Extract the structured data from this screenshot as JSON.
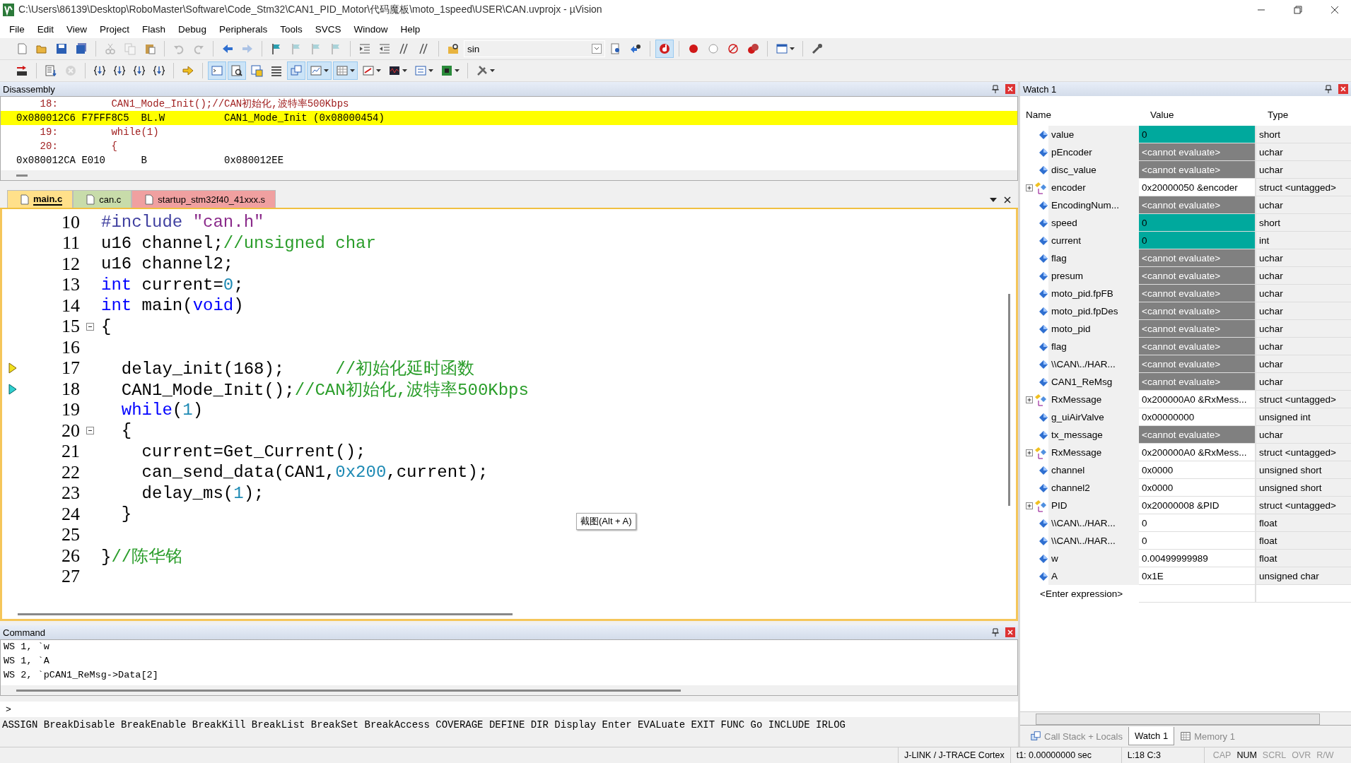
{
  "window": {
    "title": "C:\\Users\\86139\\Desktop\\RoboMaster\\Software\\Code_Stm32\\CAN1_PID_Motor\\代码魔板\\moto_1speed\\USER\\CAN.uvprojx - µVision"
  },
  "menu": [
    "File",
    "Edit",
    "View",
    "Project",
    "Flash",
    "Debug",
    "Peripherals",
    "Tools",
    "SVCS",
    "Window",
    "Help"
  ],
  "toolbars": [
    {
      "items": [
        {
          "kind": "new",
          "pressed": false,
          "disabled": false,
          "dropdown": false
        },
        {
          "kind": "open",
          "pressed": false,
          "disabled": false,
          "dropdown": false
        },
        {
          "kind": "save",
          "pressed": false,
          "disabled": false,
          "dropdown": false
        },
        {
          "kind": "saveall",
          "pressed": false,
          "disabled": false,
          "dropdown": false
        },
        {
          "kind": "separator"
        },
        {
          "kind": "cut",
          "pressed": false,
          "disabled": true,
          "dropdown": false
        },
        {
          "kind": "copy",
          "pressed": false,
          "disabled": true,
          "dropdown": false
        },
        {
          "kind": "paste",
          "pressed": false,
          "disabled": false,
          "dropdown": false
        },
        {
          "kind": "separator"
        },
        {
          "kind": "undo",
          "pressed": false,
          "disabled": true,
          "dropdown": false
        },
        {
          "kind": "redo",
          "pressed": false,
          "disabled": true,
          "dropdown": false
        },
        {
          "kind": "separator"
        },
        {
          "kind": "back",
          "pressed": false,
          "disabled": false,
          "dropdown": false
        },
        {
          "kind": "forward",
          "pressed": false,
          "disabled": true,
          "dropdown": false
        },
        {
          "kind": "separator"
        },
        {
          "kind": "bookmark",
          "pressed": false,
          "disabled": false,
          "dropdown": false
        },
        {
          "kind": "bookmark",
          "pressed": false,
          "disabled": true,
          "dropdown": false
        },
        {
          "kind": "bookmark",
          "pressed": false,
          "disabled": true,
          "dropdown": false
        },
        {
          "kind": "bookmark",
          "pressed": false,
          "disabled": true,
          "dropdown": false
        },
        {
          "kind": "separator"
        },
        {
          "kind": "indent",
          "pressed": false,
          "disabled": false,
          "dropdown": false
        },
        {
          "kind": "outdent",
          "pressed": false,
          "disabled": false,
          "dropdown": false
        },
        {
          "kind": "comment",
          "pressed": false,
          "disabled": false,
          "dropdown": false
        },
        {
          "kind": "comment",
          "pressed": false,
          "disabled": false,
          "dropdown": false
        },
        {
          "kind": "separator"
        },
        {
          "kind": "findfiles",
          "pressed": false,
          "disabled": false,
          "dropdown": false
        },
        {
          "kind": "combo",
          "value": "sin"
        },
        {
          "kind": "find",
          "pressed": false,
          "disabled": false,
          "dropdown": false
        },
        {
          "kind": "findnext",
          "pressed": false,
          "disabled": false,
          "dropdown": false
        },
        {
          "kind": "separator"
        },
        {
          "kind": "debug",
          "pressed": true,
          "disabled": false,
          "dropdown": false
        },
        {
          "kind": "separator"
        },
        {
          "kind": "breakpoint",
          "pressed": false,
          "disabled": false,
          "dropdown": false
        },
        {
          "kind": "bpempty",
          "pressed": false,
          "disabled": false,
          "dropdown": false
        },
        {
          "kind": "bpdisable",
          "pressed": false,
          "disabled": false,
          "dropdown": false
        },
        {
          "kind": "bpkill",
          "pressed": false,
          "disabled": false,
          "dropdown": false
        },
        {
          "kind": "separator"
        },
        {
          "kind": "windows",
          "pressed": false,
          "disabled": false,
          "dropdown": true
        },
        {
          "kind": "separator"
        },
        {
          "kind": "wrench",
          "pressed": false,
          "disabled": false,
          "dropdown": false
        }
      ]
    },
    {
      "items": [
        {
          "kind": "reset",
          "pressed": false,
          "disabled": false,
          "dropdown": false
        },
        {
          "kind": "separator"
        },
        {
          "kind": "run",
          "pressed": false,
          "disabled": false,
          "dropdown": false
        },
        {
          "kind": "stop",
          "pressed": false,
          "disabled": true,
          "dropdown": false
        },
        {
          "kind": "separator"
        },
        {
          "kind": "step",
          "pressed": false,
          "disabled": false,
          "dropdown": false
        },
        {
          "kind": "step",
          "pressed": false,
          "disabled": false,
          "dropdown": false
        },
        {
          "kind": "step",
          "pressed": false,
          "disabled": false,
          "dropdown": false
        },
        {
          "kind": "step",
          "pressed": false,
          "disabled": false,
          "dropdown": false
        },
        {
          "kind": "separator"
        },
        {
          "kind": "arrow",
          "pressed": false,
          "disabled": false,
          "dropdown": false
        },
        {
          "kind": "separator"
        },
        {
          "kind": "command",
          "pressed": true,
          "disabled": false,
          "dropdown": false
        },
        {
          "kind": "disassembly",
          "pressed": true,
          "disabled": false,
          "dropdown": false
        },
        {
          "kind": "symbols",
          "pressed": false,
          "disabled": false,
          "dropdown": false
        },
        {
          "kind": "registers",
          "pressed": false,
          "disabled": false,
          "dropdown": false
        },
        {
          "kind": "callstack",
          "pressed": true,
          "disabled": false,
          "dropdown": false
        },
        {
          "kind": "watch",
          "pressed": true,
          "disabled": false,
          "dropdown": true
        },
        {
          "kind": "memory",
          "pressed": true,
          "disabled": false,
          "dropdown": true
        },
        {
          "kind": "serial",
          "pressed": false,
          "disabled": false,
          "dropdown": true
        },
        {
          "kind": "analyzer",
          "pressed": false,
          "disabled": false,
          "dropdown": true
        },
        {
          "kind": "trace",
          "pressed": false,
          "disabled": false,
          "dropdown": true
        },
        {
          "kind": "board",
          "pressed": false,
          "disabled": false,
          "dropdown": true
        },
        {
          "kind": "separator"
        },
        {
          "kind": "tools",
          "pressed": false,
          "disabled": false,
          "dropdown": true
        }
      ]
    }
  ],
  "disassembly": {
    "title": "Disassembly",
    "lines": [
      {
        "kind": "source",
        "text": "    18:         CAN1_Mode_Init();//CAN初始化,波特率500Kbps",
        "highlighted": false
      },
      {
        "kind": "asm",
        "text": "0x080012C6 F7FFF8C5  BL.W          CAN1_Mode_Init (0x08000454)",
        "highlighted": true
      },
      {
        "kind": "source",
        "text": "    19:         while(1)",
        "highlighted": false
      },
      {
        "kind": "source",
        "text": "    20:         {",
        "highlighted": false
      },
      {
        "kind": "asm",
        "text": "0x080012CA E010      B             0x080012EE",
        "highlighted": false
      }
    ]
  },
  "editor_tabs": [
    {
      "label": "main.c",
      "selected": true,
      "color": "#ffe08a"
    },
    {
      "label": "can.c",
      "selected": false,
      "color": "#c8dcaa"
    },
    {
      "label": "startup_stm32f40_41xxx.s",
      "selected": false,
      "color": "#f0a0a0"
    }
  ],
  "editor": {
    "lines": [
      {
        "number": "10",
        "fold": false,
        "current": false,
        "caller": false,
        "tokens": [
          {
            "kind": "preprocessor",
            "text": "#include "
          },
          {
            "kind": "string",
            "text": "\"can.h\""
          }
        ]
      },
      {
        "number": "11",
        "fold": false,
        "current": false,
        "caller": false,
        "tokens": [
          {
            "kind": "plain",
            "text": "u16 channel;"
          },
          {
            "kind": "comment",
            "text": "//unsigned char"
          }
        ]
      },
      {
        "number": "12",
        "fold": false,
        "current": false,
        "caller": false,
        "tokens": [
          {
            "kind": "plain",
            "text": "u16 channel2;"
          }
        ]
      },
      {
        "number": "13",
        "fold": false,
        "current": false,
        "caller": false,
        "tokens": [
          {
            "kind": "keyword",
            "text": "int"
          },
          {
            "kind": "plain",
            "text": " current="
          },
          {
            "kind": "number",
            "text": "0"
          },
          {
            "kind": "plain",
            "text": ";"
          }
        ]
      },
      {
        "number": "14",
        "fold": false,
        "current": false,
        "caller": false,
        "tokens": [
          {
            "kind": "keyword",
            "text": "int"
          },
          {
            "kind": "plain",
            "text": " main("
          },
          {
            "kind": "keyword",
            "text": "void"
          },
          {
            "kind": "plain",
            "text": ")"
          }
        ]
      },
      {
        "number": "15",
        "fold": true,
        "current": false,
        "caller": false,
        "tokens": [
          {
            "kind": "plain",
            "text": "{"
          }
        ]
      },
      {
        "number": "16",
        "fold": false,
        "current": false,
        "caller": false
      },
      {
        "number": "17",
        "fold": false,
        "current": true,
        "caller": false,
        "tokens": [
          {
            "kind": "plain",
            "text": "  delay_init(168);     "
          },
          {
            "kind": "comment",
            "text": "//初始化延时函数"
          }
        ]
      },
      {
        "number": "18",
        "fold": false,
        "current": false,
        "caller": true,
        "tokens": [
          {
            "kind": "plain",
            "text": "  CAN1_Mode_Init();"
          },
          {
            "kind": "comment",
            "text": "//CAN初始化,波特率500Kbps"
          }
        ]
      },
      {
        "number": "19",
        "fold": false,
        "current": false,
        "caller": false,
        "tokens": [
          {
            "kind": "keyword",
            "text": "  while"
          },
          {
            "kind": "plain",
            "text": "("
          },
          {
            "kind": "number",
            "text": "1"
          },
          {
            "kind": "plain",
            "text": ")"
          }
        ]
      },
      {
        "number": "20",
        "fold": true,
        "current": false,
        "caller": false,
        "tokens": [
          {
            "kind": "plain",
            "text": "  {"
          }
        ]
      },
      {
        "number": "21",
        "fold": false,
        "current": false,
        "caller": false,
        "tokens": [
          {
            "kind": "plain",
            "text": "    current=Get_Current();"
          }
        ]
      },
      {
        "number": "22",
        "fold": false,
        "current": false,
        "caller": false,
        "tokens": [
          {
            "kind": "plain",
            "text": "    can_send_data(CAN1,"
          },
          {
            "kind": "number",
            "text": "0x200"
          },
          {
            "kind": "plain",
            "text": ",current);"
          }
        ]
      },
      {
        "number": "23",
        "fold": false,
        "current": false,
        "caller": false,
        "tokens": [
          {
            "kind": "plain",
            "text": "    delay_ms("
          },
          {
            "kind": "number",
            "text": "1"
          },
          {
            "kind": "plain",
            "text": ");"
          }
        ]
      },
      {
        "number": "24",
        "fold": false,
        "current": false,
        "caller": false,
        "tokens": [
          {
            "kind": "plain",
            "text": "  }"
          }
        ]
      },
      {
        "number": "25",
        "fold": false,
        "current": false,
        "caller": false
      },
      {
        "number": "26",
        "fold": false,
        "current": false,
        "caller": false,
        "tokens": [
          {
            "kind": "plain",
            "text": "}"
          },
          {
            "kind": "comment",
            "text": "//陈华铭"
          }
        ]
      },
      {
        "number": "27",
        "fold": false,
        "current": false,
        "caller": false
      }
    ],
    "tooltip": "截图(Alt + A)"
  },
  "command": {
    "title": "Command",
    "lines": [
      "WS 1, `w",
      "WS 1, `A",
      "WS 2, `pCAN1_ReMsg->Data[2]"
    ],
    "prompt": ">",
    "help": "ASSIGN BreakDisable BreakEnable BreakKill BreakList BreakSet BreakAccess COVERAGE DEFINE DIR Display Enter EVALuate EXIT FUNC Go INCLUDE IRLOG"
  },
  "watch": {
    "title": "Watch 1",
    "columns": [
      "Name",
      "Value",
      "Type"
    ],
    "rows": [
      {
        "kind": "scalar",
        "name": "value",
        "value": "0",
        "color": "#00a99d",
        "type": "short"
      },
      {
        "kind": "scalar",
        "name": "pEncoder",
        "value": "<cannot evaluate>",
        "color": "#808080",
        "type": "uchar"
      },
      {
        "kind": "scalar",
        "name": "disc_value",
        "value": "<cannot evaluate>",
        "color": "#808080",
        "type": "uchar"
      },
      {
        "kind": "struct",
        "name": "encoder",
        "value": "0x20000050 &encoder",
        "color": "#ffffff",
        "type": "struct <untagged>"
      },
      {
        "kind": "scalar",
        "name": "EncodingNum...",
        "value": "<cannot evaluate>",
        "color": "#808080",
        "type": "uchar"
      },
      {
        "kind": "scalar",
        "name": "speed",
        "value": "0",
        "color": "#00a99d",
        "type": "short"
      },
      {
        "kind": "scalar",
        "name": "current",
        "value": "0",
        "color": "#00a99d",
        "type": "int"
      },
      {
        "kind": "scalar",
        "name": "flag",
        "value": "<cannot evaluate>",
        "color": "#808080",
        "type": "uchar"
      },
      {
        "kind": "scalar",
        "name": "presum",
        "value": "<cannot evaluate>",
        "color": "#808080",
        "type": "uchar"
      },
      {
        "kind": "scalar",
        "name": "moto_pid.fpFB",
        "value": "<cannot evaluate>",
        "color": "#808080",
        "type": "uchar"
      },
      {
        "kind": "scalar",
        "name": "moto_pid.fpDes",
        "value": "<cannot evaluate>",
        "color": "#808080",
        "type": "uchar"
      },
      {
        "kind": "scalar",
        "name": "moto_pid",
        "value": "<cannot evaluate>",
        "color": "#808080",
        "type": "uchar"
      },
      {
        "kind": "scalar",
        "name": "flag",
        "value": "<cannot evaluate>",
        "color": "#808080",
        "type": "uchar"
      },
      {
        "kind": "scalar",
        "name": "\\\\CAN\\../HAR...",
        "value": "<cannot evaluate>",
        "color": "#808080",
        "type": "uchar"
      },
      {
        "kind": "scalar",
        "name": "CAN1_ReMsg",
        "value": "<cannot evaluate>",
        "color": "#808080",
        "type": "uchar"
      },
      {
        "kind": "struct",
        "name": "RxMessage",
        "value": "0x200000A0 &RxMess...",
        "color": "#ffffff",
        "type": "struct <untagged>"
      },
      {
        "kind": "scalar",
        "name": "g_uiAirValve",
        "value": "0x00000000",
        "color": "#ffffff",
        "type": "unsigned int"
      },
      {
        "kind": "scalar",
        "name": "tx_message",
        "value": "<cannot evaluate>",
        "color": "#808080",
        "type": "uchar"
      },
      {
        "kind": "struct",
        "name": "RxMessage",
        "value": "0x200000A0 &RxMess...",
        "color": "#ffffff",
        "type": "struct <untagged>"
      },
      {
        "kind": "scalar",
        "name": "channel",
        "value": "0x0000",
        "color": "#ffffff",
        "type": "unsigned short"
      },
      {
        "kind": "scalar",
        "name": "channel2",
        "value": "0x0000",
        "color": "#ffffff",
        "type": "unsigned short"
      },
      {
        "kind": "struct",
        "name": "PID",
        "value": "0x20000008 &PID",
        "color": "#ffffff",
        "type": "struct <untagged>"
      },
      {
        "kind": "scalar",
        "name": "\\\\CAN\\../HAR...",
        "value": "0",
        "color": "#ffffff",
        "type": "float"
      },
      {
        "kind": "scalar",
        "name": "\\\\CAN\\../HAR...",
        "value": "0",
        "color": "#ffffff",
        "type": "float"
      },
      {
        "kind": "scalar",
        "name": "w",
        "value": "0.00499999989",
        "color": "#ffffff",
        "type": "float"
      },
      {
        "kind": "scalar",
        "name": "A",
        "value": "0x1E",
        "color": "#ffffff",
        "type": "unsigned char"
      }
    ],
    "placeholder": "<Enter expression>"
  },
  "bottom_tabs": [
    {
      "label": "Call Stack + Locals",
      "kind": "callstack",
      "selected": false
    },
    {
      "label": "Watch 1",
      "kind": "plain",
      "selected": true
    },
    {
      "label": "Memory 1",
      "kind": "memory",
      "selected": false
    }
  ],
  "status_bar": {
    "target": "J-LINK / J-TRACE Cortex",
    "time": "t1: 0.00000000 sec",
    "position": "L:18 C:3",
    "indicators": [
      {
        "label": "CAP",
        "on": false
      },
      {
        "label": "NUM",
        "on": true
      },
      {
        "label": "SCRL",
        "on": false
      },
      {
        "label": "OVR",
        "on": false
      },
      {
        "label": "R/W",
        "on": false
      }
    ]
  }
}
